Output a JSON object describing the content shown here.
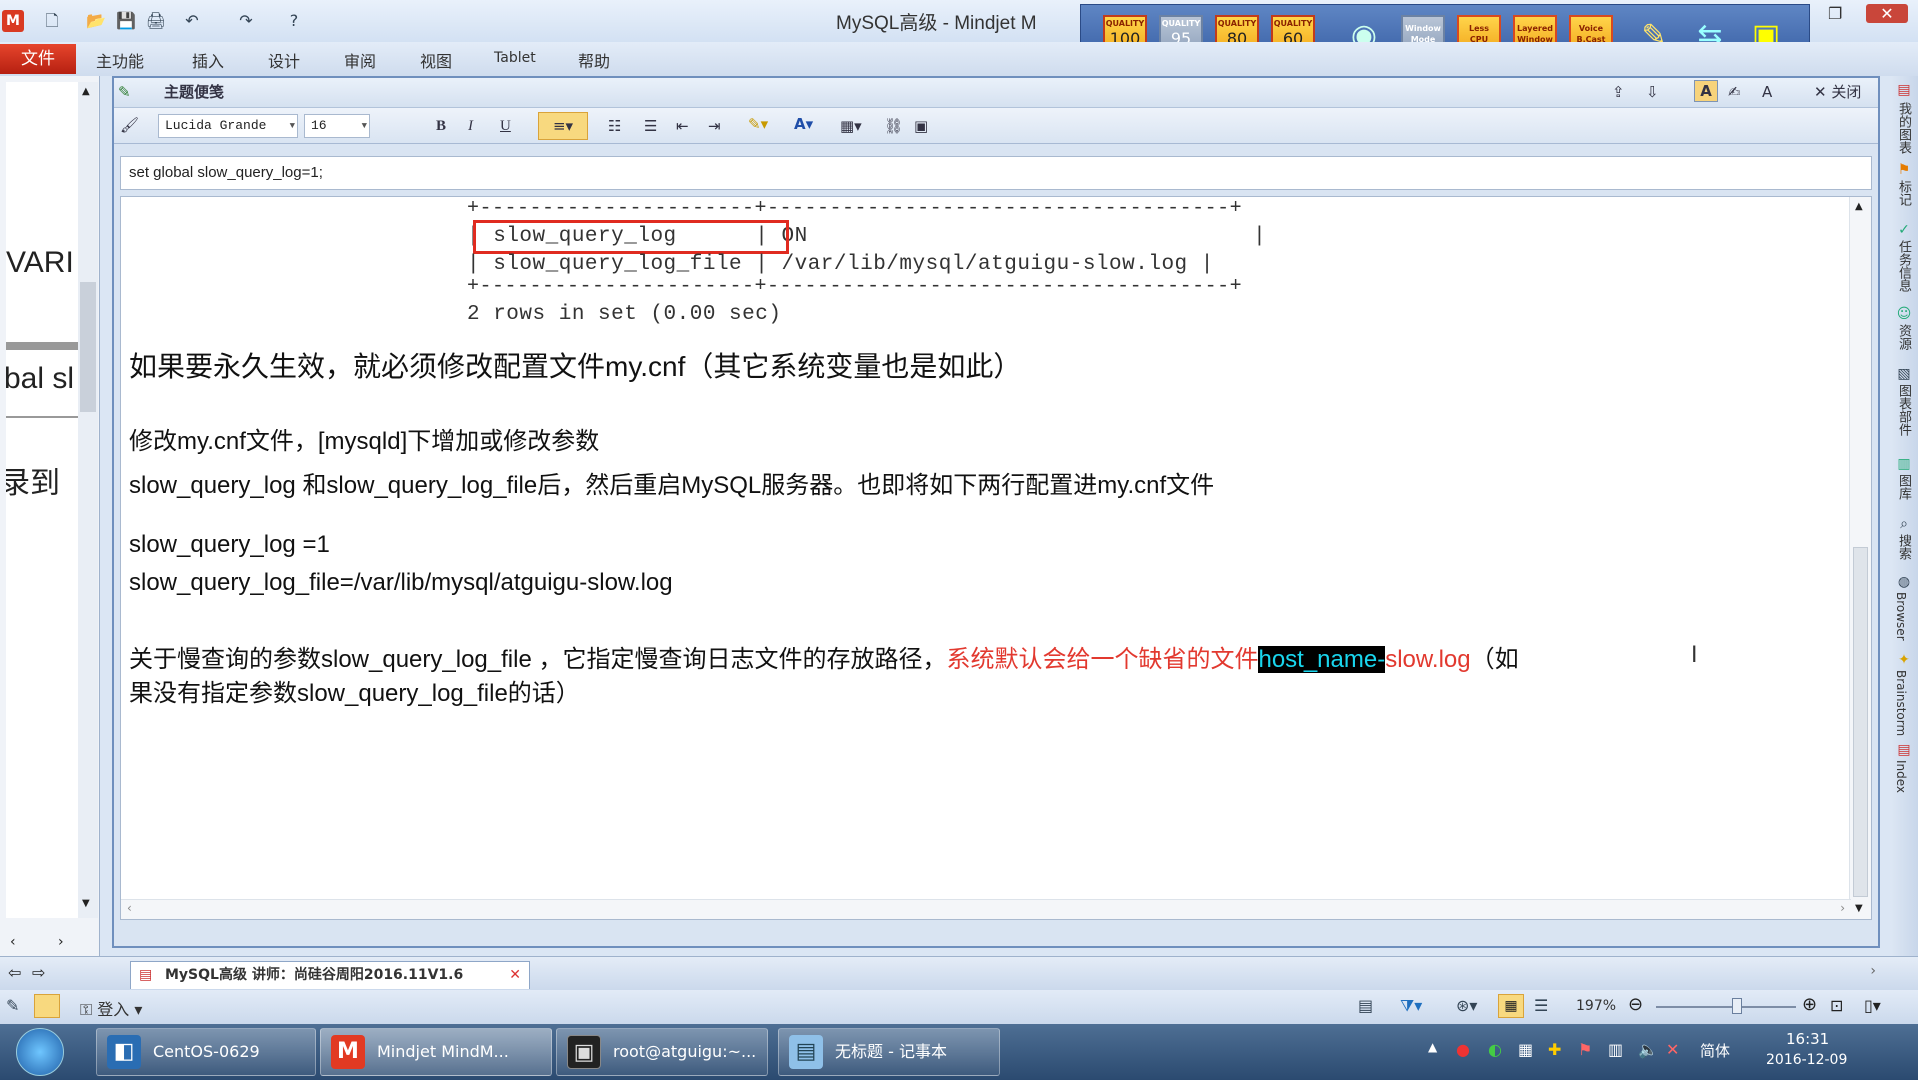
{
  "window": {
    "title": "MySQL高级 - Mindjet M",
    "logo": "M"
  },
  "plugins": [
    {
      "top": "QUALITY",
      "value": "100"
    },
    {
      "top": "QUALITY",
      "value": "95"
    },
    {
      "top": "QUALITY",
      "value": "80"
    },
    {
      "top": "QUALITY",
      "value": "60"
    }
  ],
  "plugin_buttons": [
    "Window Mode",
    "Less CPU Loading",
    "Layered Window",
    "Voice B.Cast"
  ],
  "menu": {
    "file": "文件",
    "tabs": [
      "主功能",
      "插入",
      "设计",
      "审阅",
      "视图",
      "Tablet",
      "帮助"
    ]
  },
  "left_panel": {
    "texts": [
      "VARI",
      "bal sl",
      "录到"
    ]
  },
  "notes_panel": {
    "title": "主题便笺",
    "close": "关闭"
  },
  "format": {
    "font": "Lucida Grande",
    "size": "16"
  },
  "formula": "set global slow_query_log=1;",
  "content": {
    "border_top": "+----------------------+-------------------------------------+",
    "row1": {
      "name": "slow_query_log",
      "value": "ON"
    },
    "row2": {
      "name": "slow_query_log_file",
      "value": "/var/lib/mysql/atguigu-slow.log"
    },
    "border_bottom": "+----------------------+-------------------------------------+",
    "rows_info": "2 rows in set (0.00 sec)",
    "heading": "如果要永久生效，就必须修改配置文件my.cnf（其它系统变量也是如此）",
    "line1": "修改my.cnf文件，[mysqld]下增加或修改参数",
    "line2": "slow_query_log 和slow_query_log_file后，然后重启MySQL服务器。也即将如下两行配置进my.cnf文件",
    "code1": "slow_query_log =1",
    "code2": "slow_query_log_file=/var/lib/mysql/atguigu-slow.log",
    "para_a": "关于慢查询的参数slow_query_log_file ，它指定慢查询日志文件的存放路径，",
    "para_red": "系统默认会给一个缺省的文件",
    "para_hl": "host_name-",
    "para_red2": "slow.log",
    "para_end": "（如",
    "para_line2": "果没有指定参数slow_query_log_file的话）"
  },
  "right_strip": [
    "我的图表",
    "标记",
    "任务信息",
    "资源",
    "图表部件",
    "图库",
    "搜索",
    "Browser",
    "Brainstorm",
    "Index"
  ],
  "doc_tab": "MySQL高级 讲师：尚硅谷周阳2016.11V1.6",
  "status": {
    "login": "登入",
    "zoom": "197%"
  },
  "taskbar": {
    "tasks": [
      "CentOS-0629",
      "Mindjet MindM...",
      "root@atguigu:~...",
      "无标题 - 记事本"
    ],
    "time": "16:31",
    "date": "2016-12-09",
    "ime": "简体"
  }
}
